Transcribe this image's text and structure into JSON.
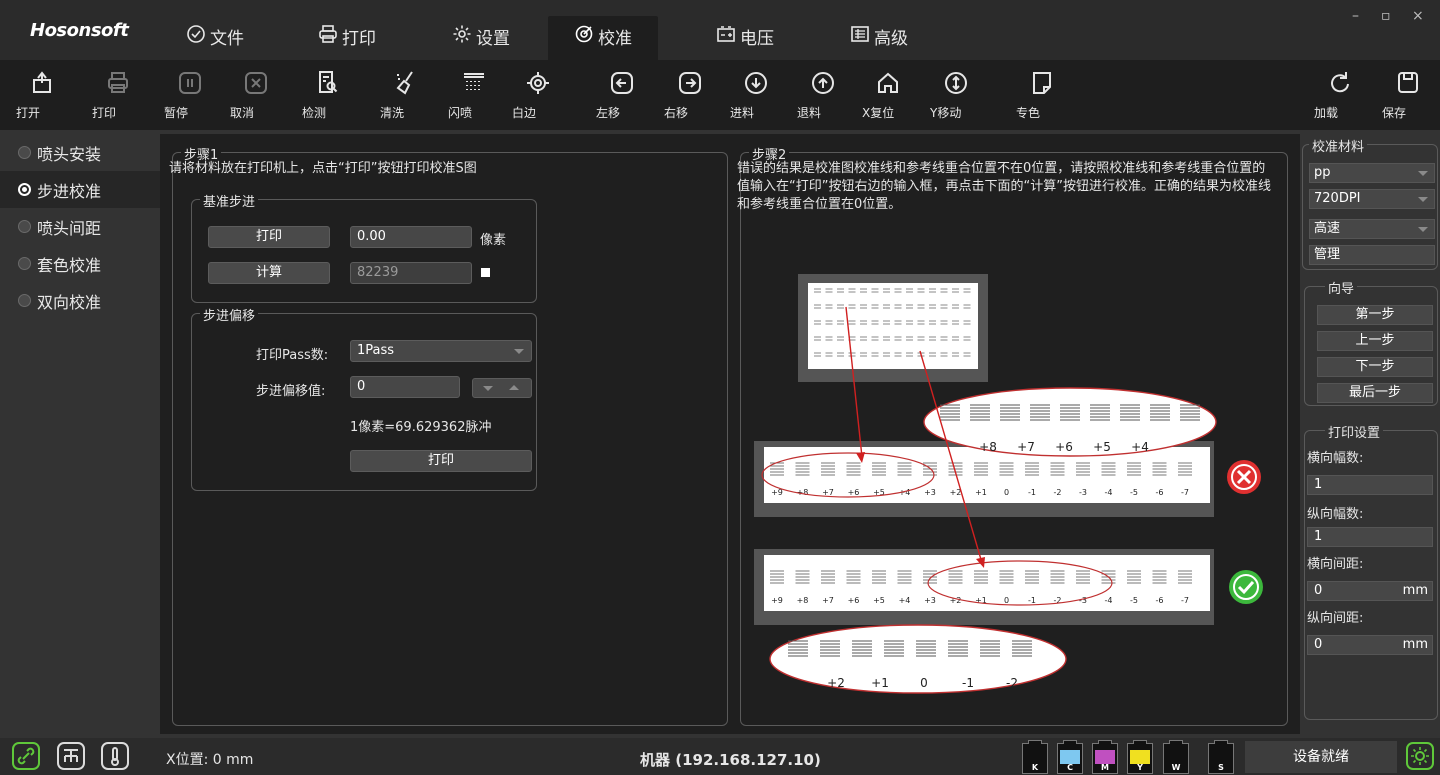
{
  "app": {
    "logo": "Hosonsoft"
  },
  "menu": {
    "items": [
      {
        "label": "文件",
        "icon": "file-check-icon"
      },
      {
        "label": "打印",
        "icon": "printer-icon"
      },
      {
        "label": "设置",
        "icon": "gear-icon"
      },
      {
        "label": "校准",
        "icon": "target-icon",
        "active": true
      },
      {
        "label": "电压",
        "icon": "battery-icon"
      },
      {
        "label": "高级",
        "icon": "list-icon"
      }
    ]
  },
  "window_controls": {
    "minimize": "–",
    "restore": "▫",
    "close": "×"
  },
  "toolbar": {
    "open": "打开",
    "print": "打印",
    "pause": "暂停",
    "cancel": "取消",
    "detect": "检测",
    "clean": "清洗",
    "flash": "闪喷",
    "white_edge": "白边",
    "move_left": "左移",
    "move_right": "右移",
    "feed": "进料",
    "retract": "退料",
    "x_reset": "X复位",
    "y_move": "Y移动",
    "spot_color": "专色",
    "load": "加载",
    "save": "保存"
  },
  "leftnav": {
    "items": [
      {
        "label": "喷头安装",
        "active": false
      },
      {
        "label": "步进校准",
        "active": true
      },
      {
        "label": "喷头间距",
        "active": false
      },
      {
        "label": "套色校准",
        "active": false
      },
      {
        "label": "双向校准",
        "active": false
      }
    ]
  },
  "step1": {
    "title": "步骤1",
    "desc": "请将材料放在打印机上，点击“打印”按钮打印校准S图",
    "base": {
      "title": "基准步进",
      "print_btn": "打印",
      "value": "0.00",
      "unit": "像素",
      "calc_btn": "计算",
      "calc_value": "82239"
    },
    "offset": {
      "title": "步进偏移",
      "pass_label": "打印Pass数:",
      "pass_value": "1Pass",
      "offset_label": "步进偏移值:",
      "offset_value": "0",
      "ratio": "1像素=69.629362脉冲",
      "print_btn": "打印"
    }
  },
  "step2": {
    "title": "步骤2",
    "desc": "错误的结果是校准图校准线和参考线重合位置不在0位置，请按照校准线和参考线重合位置的值输入在“打印”按钮右边的输入框，再点击下面的“计算”按钮进行校准。正确的结果为校准线和参考线重合位置在0位置。",
    "diagram": {
      "zoom_top_labels": [
        "+8",
        "+7",
        "+6",
        "+5",
        "+4"
      ],
      "strip_labels": [
        "+9",
        "+8",
        "+7",
        "+6",
        "+5",
        "+4",
        "+3",
        "+2",
        "+1",
        "0",
        "-1",
        "-2",
        "-3",
        "-4",
        "-5",
        "-6",
        "-7"
      ],
      "zoom_bottom_labels": [
        "+2",
        "+1",
        "0",
        "-1",
        "-2"
      ]
    }
  },
  "right": {
    "material": {
      "title": "校准材料",
      "media": "pp",
      "dpi": "720DPI",
      "speed": "高速",
      "manage": "管理"
    },
    "wizard": {
      "title": "向导",
      "first": "第一步",
      "prev": "上一步",
      "next": "下一步",
      "last": "最后一步"
    },
    "print_settings": {
      "title": "打印设置",
      "h_count_label": "横向幅数:",
      "h_count": "1",
      "v_count_label": "纵向幅数:",
      "v_count": "1",
      "h_gap_label": "横向间距:",
      "h_gap": "0",
      "v_gap_label": "纵向间距:",
      "v_gap": "0",
      "unit": "mm"
    }
  },
  "status": {
    "x_position": "X位置: 0 mm",
    "machine": "机器  (192.168.127.10)",
    "inks": [
      {
        "tag": "K",
        "color": "#111111"
      },
      {
        "tag": "C",
        "color": "#7ec8f0"
      },
      {
        "tag": "M",
        "color": "#c050c0"
      },
      {
        "tag": "Y",
        "color": "#f0e020"
      },
      {
        "tag": "W",
        "color": "#111111"
      },
      {
        "tag": "S",
        "color": "#111111"
      }
    ],
    "ready": "设备就绪"
  },
  "colors": {
    "accent_green": "#5fc83a",
    "error_red": "#e03030",
    "ok_green": "#3cb83c"
  }
}
